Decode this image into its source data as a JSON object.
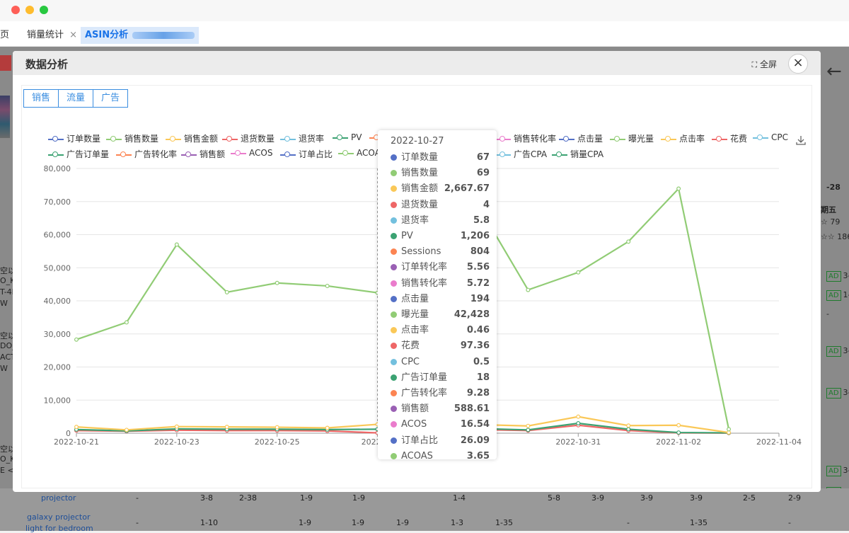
{
  "tabs": [
    {
      "label": "页"
    },
    {
      "label": "销量统计"
    },
    {
      "label": "ASIN分析"
    }
  ],
  "tab_close": "×",
  "background": {
    "right_date": "-28",
    "right_weekday": "期五",
    "right_r1": "☆ 79",
    "right_r2": "☆☆ 186",
    "ad": "AD",
    "left_lines": [
      "空以",
      "O_K",
      "T-4K",
      "W",
      "空以",
      "DO_",
      "ACT",
      "W",
      "空以",
      "O_K",
      "E <"
    ],
    "ad_vals": [
      "3-",
      "1-",
      "-",
      "3-",
      "3-",
      "3-",
      "3-"
    ],
    "row_keyword1": "projector",
    "row_keyword2a": "galaxy projector",
    "row_keyword2b": "light for bedroom",
    "row_cells1": [
      "-",
      "3-8",
      "2-38",
      "1-9",
      "1-9",
      "1-4",
      "5-8",
      "3-9",
      "3-9",
      "3-9",
      "2-5",
      "2-9"
    ],
    "row_cells2": [
      "-",
      "1-10",
      "1-9",
      "1-9",
      "1-9",
      "1-3",
      "1-35",
      "-",
      "1-35",
      "-"
    ]
  },
  "modal": {
    "title": "数据分析",
    "fullscreen": "全屏",
    "close": "×",
    "buttons": [
      "销售",
      "流量",
      "广告"
    ]
  },
  "legend": [
    {
      "name": "订单数量",
      "color": "#5470c6"
    },
    {
      "name": "销售数量",
      "color": "#91cc75"
    },
    {
      "name": "销售金额",
      "color": "#fac858"
    },
    {
      "name": "退货数量",
      "color": "#ee6666"
    },
    {
      "name": "退货率",
      "color": "#73c0de"
    },
    {
      "name": "PV",
      "color": "#3ba272"
    },
    {
      "name": "Sessions",
      "color": "#fc8452"
    },
    {
      "name": "订单转化率",
      "color": "#9a60b4"
    },
    {
      "name": "销售转化率",
      "color": "#ea7ccc"
    },
    {
      "name": "点击量",
      "color": "#5470c6"
    },
    {
      "name": "曝光量",
      "color": "#91cc75"
    },
    {
      "name": "点击率",
      "color": "#fac858"
    },
    {
      "name": "花费",
      "color": "#ee6666"
    },
    {
      "name": "CPC",
      "color": "#73c0de"
    },
    {
      "name": "广告订单量",
      "color": "#3ba272"
    },
    {
      "name": "广告转化率",
      "color": "#fc8452"
    },
    {
      "name": "销售额",
      "color": "#9a60b4"
    },
    {
      "name": "ACOS",
      "color": "#ea7ccc"
    },
    {
      "name": "订单占比",
      "color": "#5470c6"
    },
    {
      "name": "ACOAS",
      "color": "#91cc75"
    },
    {
      "name": "广告CPA",
      "color": "#73c0de"
    },
    {
      "name": "销量CPA",
      "color": "#3ba272"
    }
  ],
  "tooltip": {
    "date": "2022-10-27",
    "rows": [
      {
        "name": "订单数量",
        "value": "67",
        "color": "#5470c6"
      },
      {
        "name": "销售数量",
        "value": "69",
        "color": "#91cc75"
      },
      {
        "name": "销售金额",
        "value": "2,667.67",
        "color": "#fac858"
      },
      {
        "name": "退货数量",
        "value": "4",
        "color": "#ee6666"
      },
      {
        "name": "退货率",
        "value": "5.8",
        "color": "#73c0de"
      },
      {
        "name": "PV",
        "value": "1,206",
        "color": "#3ba272"
      },
      {
        "name": "Sessions",
        "value": "804",
        "color": "#fc8452"
      },
      {
        "name": "订单转化率",
        "value": "5.56",
        "color": "#9a60b4"
      },
      {
        "name": "销售转化率",
        "value": "5.72",
        "color": "#ea7ccc"
      },
      {
        "name": "点击量",
        "value": "194",
        "color": "#5470c6"
      },
      {
        "name": "曝光量",
        "value": "42,428",
        "color": "#91cc75"
      },
      {
        "name": "点击率",
        "value": "0.46",
        "color": "#fac858"
      },
      {
        "name": "花费",
        "value": "97.36",
        "color": "#ee6666"
      },
      {
        "name": "CPC",
        "value": "0.5",
        "color": "#73c0de"
      },
      {
        "name": "广告订单量",
        "value": "18",
        "color": "#3ba272"
      },
      {
        "name": "广告转化率",
        "value": "9.28",
        "color": "#fc8452"
      },
      {
        "name": "销售额",
        "value": "588.61",
        "color": "#9a60b4"
      },
      {
        "name": "ACOS",
        "value": "16.54",
        "color": "#ea7ccc"
      },
      {
        "name": "订单占比",
        "value": "26.09",
        "color": "#5470c6"
      },
      {
        "name": "ACOAS",
        "value": "3.65",
        "color": "#91cc75"
      }
    ]
  },
  "chart_data": {
    "type": "line",
    "x": [
      "2022-10-21",
      "2022-10-22",
      "2022-10-23",
      "2022-10-24",
      "2022-10-25",
      "2022-10-26",
      "2022-10-27",
      "2022-10-28",
      "2022-10-29",
      "2022-10-30",
      "2022-10-31",
      "2022-11-01",
      "2022-11-02",
      "2022-11-03",
      "2022-11-04"
    ],
    "xticks": [
      "2022-10-21",
      "2022-10-23",
      "2022-10-25",
      "2022-10-27",
      "2022-10-29",
      "2022-10-31",
      "2022-11-02",
      "2022-11-04"
    ],
    "xtick_labels": [
      "2022-10-21",
      "2022-10-23",
      "2022-10-25",
      "2022-10",
      "",
      "2022-10-31",
      "2022-11-02",
      "2022-11-04"
    ],
    "xtick_partial": [
      "",
      "",
      "",
      "",
      "9",
      "",
      "",
      ""
    ],
    "yticks": [
      "0",
      "10,000",
      "20,000",
      "30,000",
      "40,000",
      "50,000",
      "60,000",
      "70,000",
      "80,000"
    ],
    "ylim": [
      0,
      80000
    ],
    "series": [
      {
        "name": "曝光量",
        "color": "#91cc75",
        "values": [
          28300,
          33500,
          57000,
          42600,
          45400,
          44500,
          42428,
          54000,
          69000,
          43300,
          48600,
          57900,
          73900,
          1200,
          null
        ]
      },
      {
        "name": "销售金额",
        "color": "#fac858",
        "values": [
          1900,
          1000,
          2000,
          1900,
          1800,
          1600,
          2667.67,
          2500,
          2600,
          2200,
          5000,
          2300,
          2400,
          200,
          null
        ]
      },
      {
        "name": "PV",
        "color": "#3ba272",
        "values": [
          1100,
          700,
          1300,
          1200,
          1200,
          1100,
          1206,
          1300,
          1400,
          1000,
          3000,
          1200,
          200,
          100,
          null
        ]
      },
      {
        "name": "花费",
        "color": "#ee6666",
        "values": [
          800,
          600,
          900,
          800,
          800,
          700,
          97.36,
          900,
          1100,
          800,
          2400,
          800,
          100,
          50,
          null
        ]
      }
    ]
  }
}
